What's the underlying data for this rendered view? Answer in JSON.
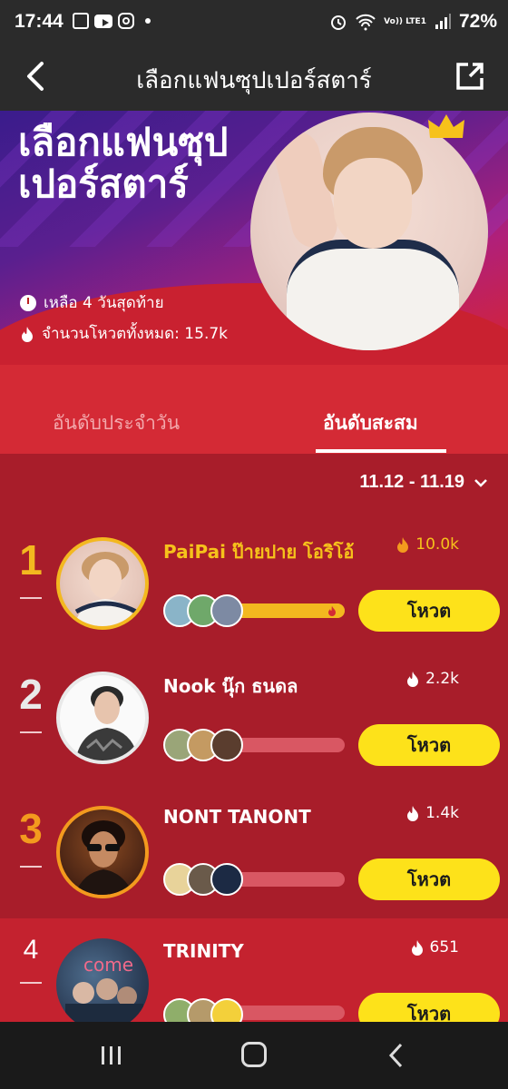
{
  "status_bar": {
    "time": "17:44",
    "battery": "72%",
    "lte": "Vo)) LTE1"
  },
  "nav": {
    "title": "เลือกแฟนซุปเปอร์สตาร์"
  },
  "banner": {
    "title": "เลือกแฟนซุปเปอร์สตาร์",
    "remaining": "เหลือ 4 วันสุดท้าย",
    "total_votes": "จำนวนโหวตทั้งหมด: 15.7k"
  },
  "tabs": {
    "daily": "อันดับประจำวัน",
    "cumulative": "อันดับสะสม",
    "active": "cumulative"
  },
  "date_range": "11.12 - 11.19",
  "colors": {
    "gold": "#f3b81f",
    "silver": "#e9e9e9",
    "bronze": "#f39a1e",
    "vote_button": "#fde21a",
    "row_bg": "#a81d2a"
  },
  "rows": [
    {
      "rank": "1",
      "name": "PaiPai ป๊ายปาย โอริโอ้",
      "votes": "10.0k",
      "progress": 1.0,
      "button": "โหวต"
    },
    {
      "rank": "2",
      "name": "Nook นุ๊ก ธนดล",
      "votes": "2.2k",
      "progress": 0.32,
      "button": "โหวต"
    },
    {
      "rank": "3",
      "name": "NONT TANONT",
      "votes": "1.4k",
      "progress": 0.2,
      "button": "โหวต"
    },
    {
      "rank": "4",
      "name": "TRINITY",
      "votes": "651",
      "progress": 0.1,
      "button": "โหวต"
    }
  ]
}
